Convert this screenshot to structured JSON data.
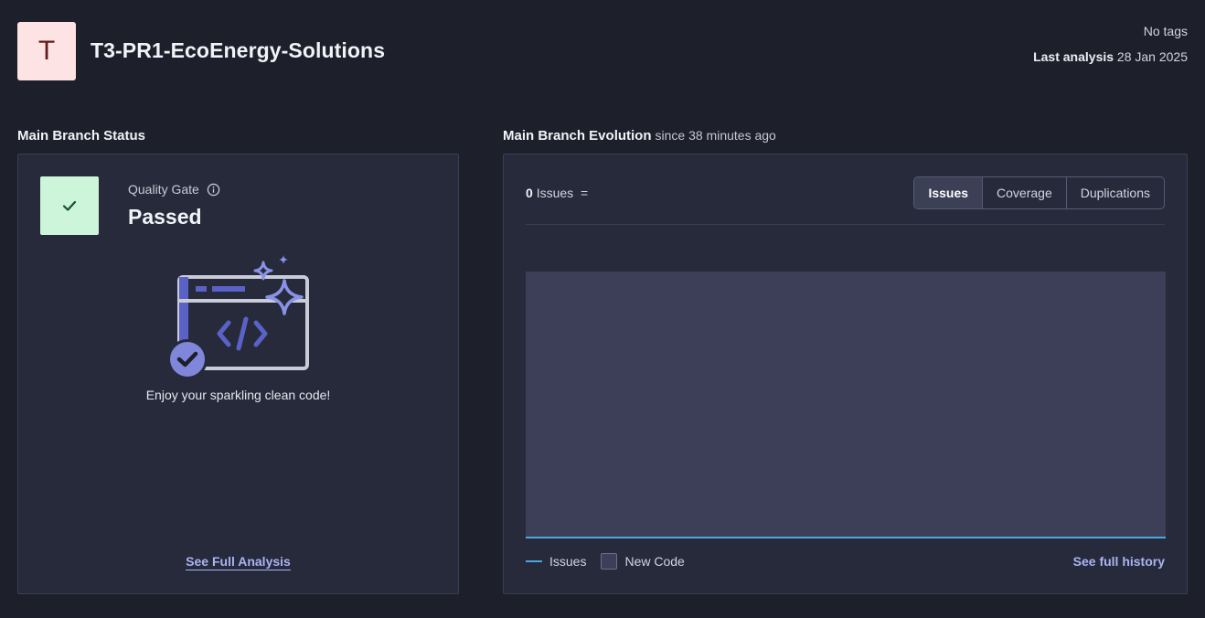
{
  "project": {
    "avatar_letter": "T",
    "name": "T3-PR1-EcoEnergy-Solutions",
    "tags": "No tags",
    "last_analysis_label": "Last analysis",
    "last_analysis_date": "28 Jan 2025"
  },
  "status_section": {
    "title": "Main Branch Status",
    "quality_gate_label": "Quality Gate",
    "quality_gate_status": "Passed",
    "message": "Enjoy your sparkling clean code!",
    "see_full_analysis": "See Full Analysis"
  },
  "evolution_section": {
    "title": "Main Branch Evolution",
    "since": "since 38 minutes ago",
    "issues_count": "0",
    "issues_label": "Issues",
    "issues_trend": "=",
    "tabs": [
      {
        "label": "Issues",
        "active": true
      },
      {
        "label": "Coverage",
        "active": false
      },
      {
        "label": "Duplications",
        "active": false
      }
    ],
    "legend": {
      "issues": "Issues",
      "new_code": "New Code"
    },
    "see_full_history": "See full history"
  },
  "colors": {
    "background": "#1d1f2b",
    "card": "#262a3b",
    "accent_link": "#aab4f2",
    "passed_green": "#cdf5da",
    "issues_line": "#4aa8e0",
    "new_code_area": "#3c3f57",
    "illustration": "#5a62c7"
  },
  "icons": {
    "quality_gate": "check-icon",
    "info": "info-icon",
    "illustration": "clean-code-illustration"
  }
}
